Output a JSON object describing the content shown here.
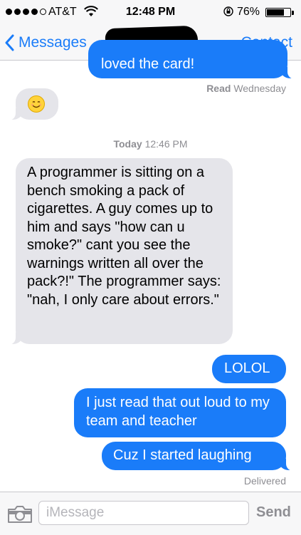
{
  "status_bar": {
    "carrier": "AT&T",
    "time": "12:48 PM",
    "battery": "76%",
    "battery_level": 0.76
  },
  "nav": {
    "back_label": "Messages",
    "contact_label": "Contact"
  },
  "messages": [
    {
      "direction": "outgoing",
      "text": "loved the card!"
    },
    {
      "direction": "incoming",
      "content": "smiling-face-emoji"
    },
    {
      "direction": "incoming",
      "text": "A programmer is sitting on a bench smoking a pack of cigarettes. A guy comes up to him and says \"how can u smoke?\" cant you see the warnings written all over the pack?!\" The programmer says: \"nah, I only care about errors.\""
    },
    {
      "direction": "outgoing",
      "text": "LOLOL"
    },
    {
      "direction": "outgoing",
      "text": "I just read that out loud to my team and teacher"
    },
    {
      "direction": "outgoing",
      "text": "Cuz I started laughing"
    }
  ],
  "read_receipt": {
    "label": "Read",
    "when": "Wednesday"
  },
  "timestamp": {
    "day": "Today",
    "time": "12:46 PM"
  },
  "delivered_label": "Delivered",
  "input": {
    "placeholder": "iMessage",
    "send_label": "Send"
  },
  "colors": {
    "accent": "#1a7cf9",
    "incoming_bubble": "#e5e5ea",
    "meta_text": "#8e8e93"
  }
}
